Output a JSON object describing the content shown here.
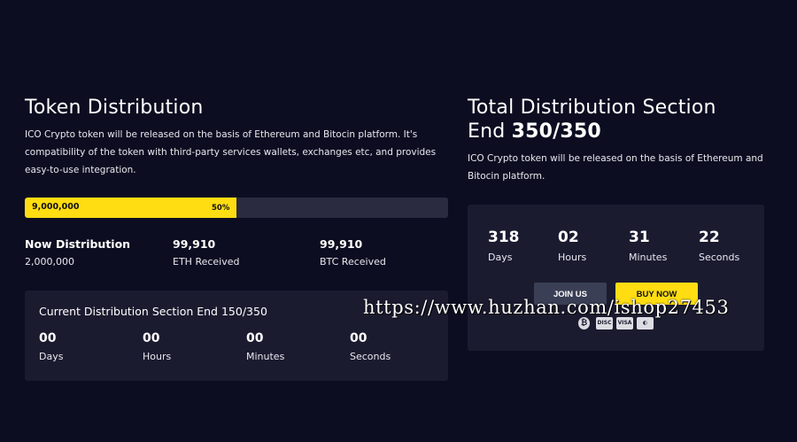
{
  "left": {
    "title": "Token Distribution",
    "description": "ICO Crypto token will be released on the basis of Ethereum and Bitocin platform. It's compatibility of the token with third-party services wallets, exchanges etc, and provides easy-to-use integration.",
    "progress": {
      "amount": "9,000,000",
      "percent_label": "50%",
      "fraction": 0.5
    },
    "stats": [
      {
        "title": "Now Distribution",
        "sub": "2,000,000"
      },
      {
        "title": "99,910",
        "sub": "ETH Received"
      },
      {
        "title": "99,910",
        "sub": "BTC Received"
      }
    ],
    "card": {
      "title": "Current Distribution Section End 150/350",
      "countdown": [
        {
          "value": "00",
          "label": "Days"
        },
        {
          "value": "00",
          "label": "Hours"
        },
        {
          "value": "00",
          "label": "Minutes"
        },
        {
          "value": "00",
          "label": "Seconds"
        }
      ]
    }
  },
  "right": {
    "title_line1": "Total Distribution Section",
    "title_line2_prefix": "End ",
    "title_line2_bold": "350/350",
    "description": "ICO Crypto token will be released on the basis of Ethereum and Bitocin platform.",
    "countdown": [
      {
        "value": "318",
        "label": "Days"
      },
      {
        "value": "02",
        "label": "Hours"
      },
      {
        "value": "31",
        "label": "Minutes"
      },
      {
        "value": "22",
        "label": "Seconds"
      }
    ],
    "join_label": "JOIN US",
    "buy_label": "BUY NOW",
    "payment_icons": [
      {
        "name": "bitcoin-icon",
        "glyph": "₿"
      },
      {
        "name": "discover-card-icon",
        "glyph": "DISC"
      },
      {
        "name": "visa-card-icon",
        "glyph": "VISA"
      },
      {
        "name": "mastercard-icon",
        "glyph": "◐"
      }
    ]
  },
  "watermark": "https://www.huzhan.com/ishop27453",
  "colors": {
    "background": "#0d0d21",
    "card": "#1b1b30",
    "accent": "#ffdd12",
    "track": "#2a2b40"
  }
}
